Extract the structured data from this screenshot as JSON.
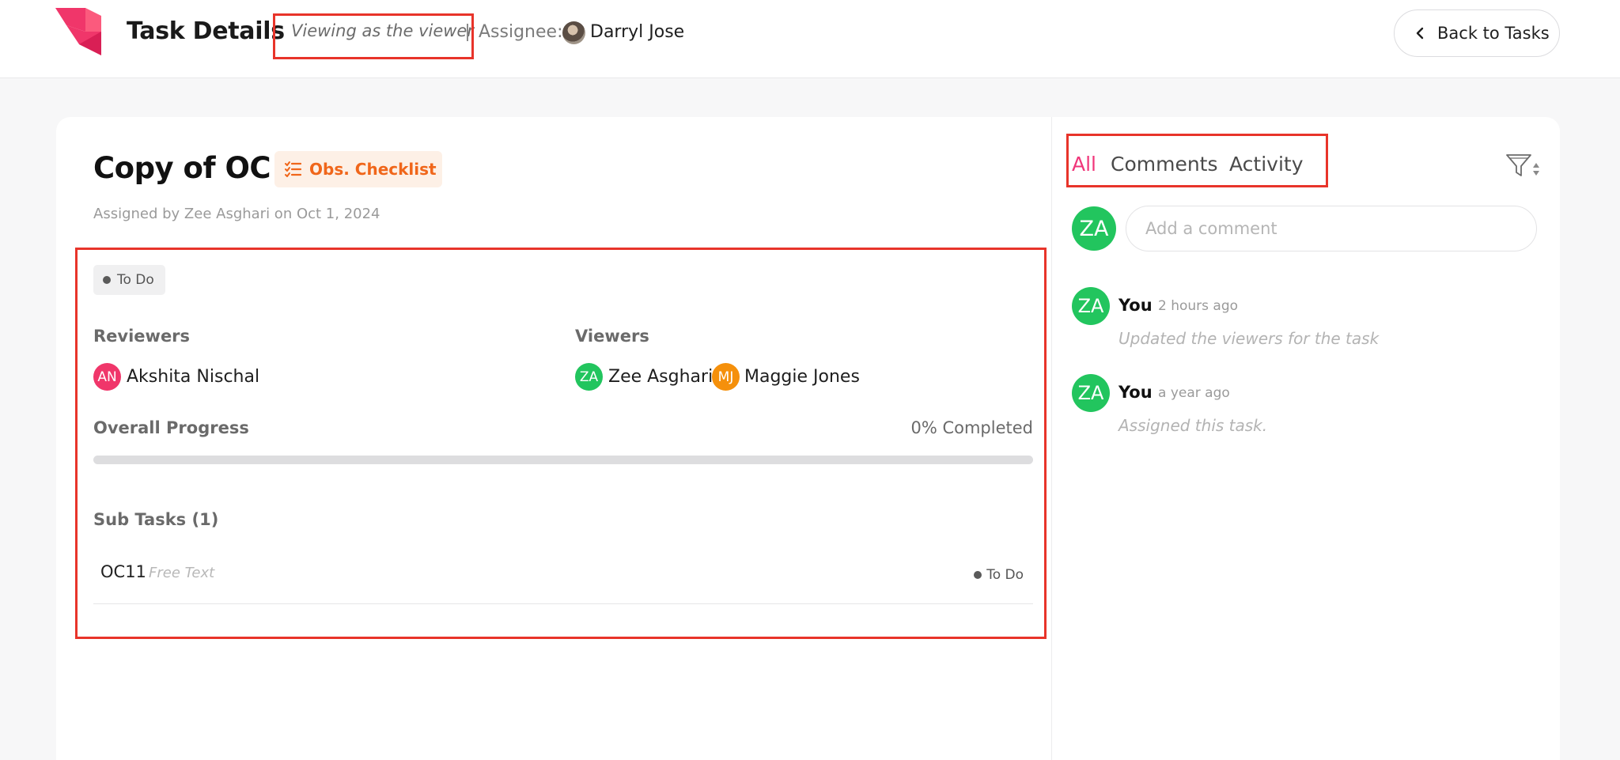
{
  "header": {
    "title": "Task Details",
    "viewing_note": "Viewing as the viewer",
    "assignee_label": "Assignee:",
    "assignee_name": "Darryl Jose",
    "back_label": "Back to Tasks"
  },
  "task": {
    "title": "Copy of OC 1",
    "type_label": "Obs. Checklist",
    "assigned_by": "Assigned by Zee Asghari on  Oct 1, 2024",
    "status": "To Do",
    "reviewers_label": "Reviewers",
    "reviewers": [
      {
        "initials": "AN",
        "name": "Akshita Nischal",
        "color": "#f0366a"
      }
    ],
    "viewers_label": "Viewers",
    "viewers": [
      {
        "initials": "ZA",
        "name": "Zee Asghari,",
        "color": "#22c55e"
      },
      {
        "initials": "MJ",
        "name": "Maggie Jones",
        "color": "#f5900b"
      }
    ],
    "progress_label": "Overall Progress",
    "progress_text": "0% Completed",
    "progress_percent": 0,
    "subtasks_label": "Sub Tasks (1)",
    "subtasks": [
      {
        "name": "OC11",
        "type": "Free Text",
        "status": "To Do"
      }
    ]
  },
  "panel": {
    "tabs": [
      "All",
      "Comments",
      "Activity"
    ],
    "active_tab": "All",
    "comment_avatar": "ZA",
    "comment_placeholder": "Add a comment",
    "activity": [
      {
        "initials": "ZA",
        "user": "You",
        "time": "2 hours ago",
        "text": "Updated the viewers for the task"
      },
      {
        "initials": "ZA",
        "user": "You",
        "time": "a year ago",
        "text": "Assigned this task."
      }
    ]
  },
  "colors": {
    "accent_pink": "#f0367a",
    "badge_orange": "#f0661a",
    "avatar_green": "#22c55e",
    "annotation_red": "#e8342a"
  },
  "icons": [
    "app-logo-icon",
    "chevron-left-icon",
    "checklist-icon",
    "filter-sort-icon"
  ]
}
